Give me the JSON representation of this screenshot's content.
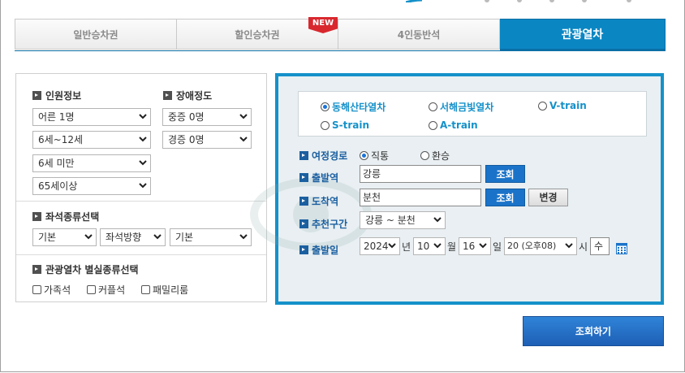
{
  "tabs": [
    {
      "label": "일반승차권"
    },
    {
      "label": "할인승차권",
      "badge": "NEW"
    },
    {
      "label": "4인동반석"
    },
    {
      "label": "관광열차"
    }
  ],
  "left": {
    "passengers_title": "인원정보",
    "disability_title": "장애정도",
    "passenger_selects": [
      "어른 1명",
      "6세~12세",
      "6세 미만",
      "65세이상"
    ],
    "disability_selects": [
      "중증 0명",
      "경증 0명"
    ],
    "seat_title": "좌석종류선택",
    "seat_selects": [
      "기본",
      "좌석방향",
      "기본"
    ],
    "room_title": "관광열차 별실종류선택",
    "room_options": [
      "가족석",
      "커플석",
      "패밀리룸"
    ]
  },
  "right": {
    "trains": [
      {
        "label": "동해산타열차",
        "selected": true
      },
      {
        "label": "서해금빛열차",
        "selected": false
      },
      {
        "label": "V-train",
        "selected": false
      },
      {
        "label": "S-train",
        "selected": false
      },
      {
        "label": "A-train",
        "selected": false
      }
    ],
    "route_label": "여정경로",
    "route_options": [
      {
        "label": "직통",
        "selected": true
      },
      {
        "label": "환승",
        "selected": false
      }
    ],
    "departure_label": "출발역",
    "departure_value": "강릉",
    "arrival_label": "도착역",
    "arrival_value": "분천",
    "lookup_label": "조회",
    "change_label": "변경",
    "section_label": "추천구간",
    "section_value": "강릉 ~ 분천",
    "date_label": "출발일",
    "year": "2024",
    "year_unit": "년",
    "month": "10",
    "month_unit": "월",
    "day": "16",
    "day_unit": "일",
    "hour": "20 (오후08)",
    "hour_unit": "시",
    "weekday": "수"
  },
  "submit_label": "조회하기",
  "colors": {
    "accent": "#0a86c3",
    "label_blue": "#1a5fa0",
    "button_blue": "#1a73c8",
    "badge_red": "#d8282e"
  }
}
